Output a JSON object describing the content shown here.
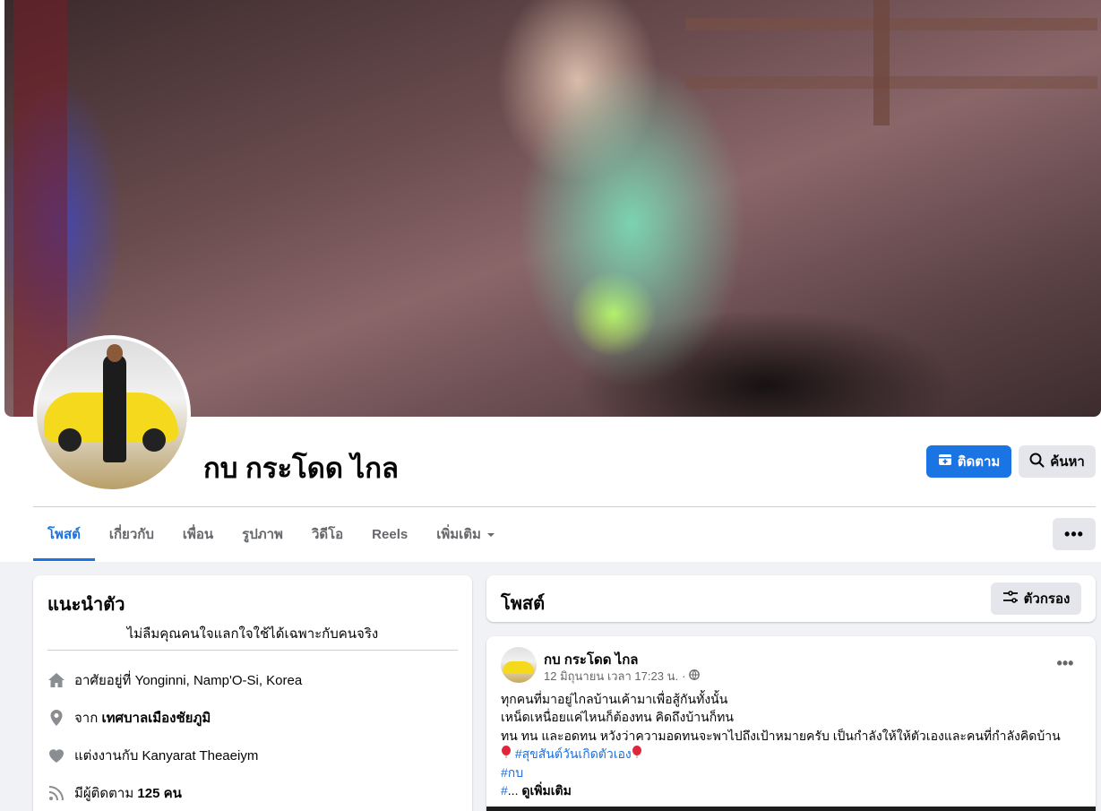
{
  "profile": {
    "name": "กบ กระโดด ไกล"
  },
  "actions": {
    "follow_label": "ติดตาม",
    "search_label": "ค้นหา",
    "more_label": "•••"
  },
  "tabs": [
    {
      "label": "โพสต์",
      "active": true
    },
    {
      "label": "เกี่ยวกับ"
    },
    {
      "label": "เพื่อน"
    },
    {
      "label": "รูปภาพ"
    },
    {
      "label": "วิดีโอ"
    },
    {
      "label": "Reels"
    },
    {
      "label": "เพิ่มเติม"
    }
  ],
  "intro": {
    "title": "แนะนำตัว",
    "bio": "ไม่ลืมคุณคนใจแลกใจใช้ได้เฉพาะกับคนจริง",
    "lives_prefix": "อาศัยอยู่ที่",
    "lives_value": "Yonginni, Namp'O-Si, Korea",
    "from_prefix": "จาก",
    "from_value": "เทศบาลเมืองชัยภูมิ",
    "married_prefix": "แต่งงานกับ",
    "married_value": "Kanyarat Theaeiym",
    "followers_prefix": "มีผู้ติดตาม",
    "followers_value": "125 คน"
  },
  "posts_section": {
    "title": "โพสต์",
    "filter_label": "ตัวกรอง"
  },
  "post": {
    "author": "กบ กระโดด ไกล",
    "date": "12 มิถุนายน เวลา 17:23 น.",
    "dot": "·",
    "line1": "ทุกคนที่มาอยู่ไกลบ้านเค้ามาเพื่อสู้กันทั้งนั้น",
    "line2": "เหน็ดเหนื่อยแค่ไหนก็ต้องทน คิดถึงบ้านก็ทน",
    "line3": "ทน ทน และอดทน หวังว่าความอดทนจะพาไปถึงเป้าหมายครับ เป็นกำลังให้ให้ตัวเองและคนที่กำลังคิดบ้าน",
    "hashtag1": "#สุขสันต์วันเกิดตัวเอง",
    "hashtag2": "#กบ",
    "hashtag3": "#",
    "ellipsis": "...",
    "see_more": "ดูเพิ่มเติม"
  },
  "colors": {
    "accent": "#1b74e4",
    "hashtag": "#216fdb",
    "background": "#f0f2f5"
  }
}
